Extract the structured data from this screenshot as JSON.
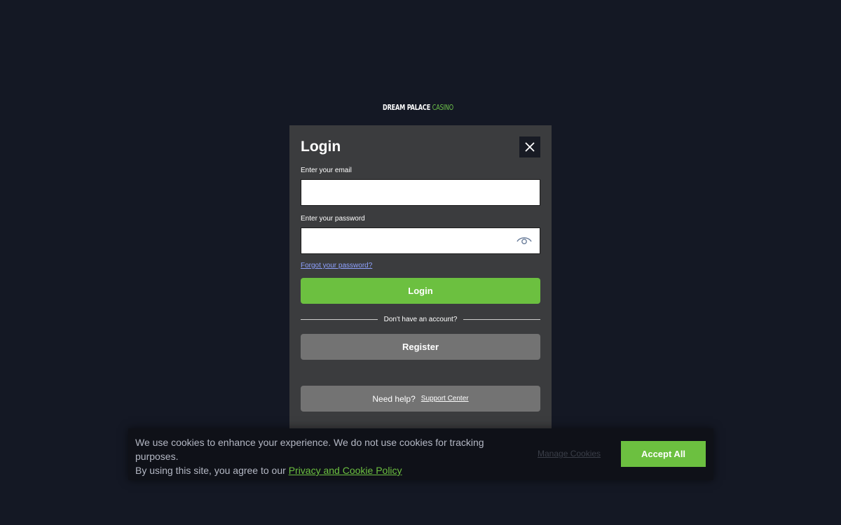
{
  "brand": {
    "logo_dream": "DREAM PALACE",
    "logo_casino": "CASINO",
    "accent_color": "#6cc040"
  },
  "login_modal": {
    "title": "Login",
    "close_icon": "close-icon",
    "email_label": "Enter your email",
    "email_value": "",
    "password_label": "Enter your password",
    "password_value": "",
    "password_toggle_icon": "eye-icon",
    "forgot_link": "Forgot your password?",
    "login_button": "Login",
    "divider_text": "Don't have an account?",
    "register_button": "Register",
    "help_text": "Need help?",
    "support_link": "Support Center"
  },
  "cookie_banner": {
    "text_line1": "We use cookies to enhance your experience. We do not use cookies for tracking purposes.",
    "text_line2": "By using this site, you agree to our",
    "policy_link": "Privacy and Cookie Policy",
    "manage_link": "Manage Cookies",
    "accept_button": "Accept All"
  }
}
